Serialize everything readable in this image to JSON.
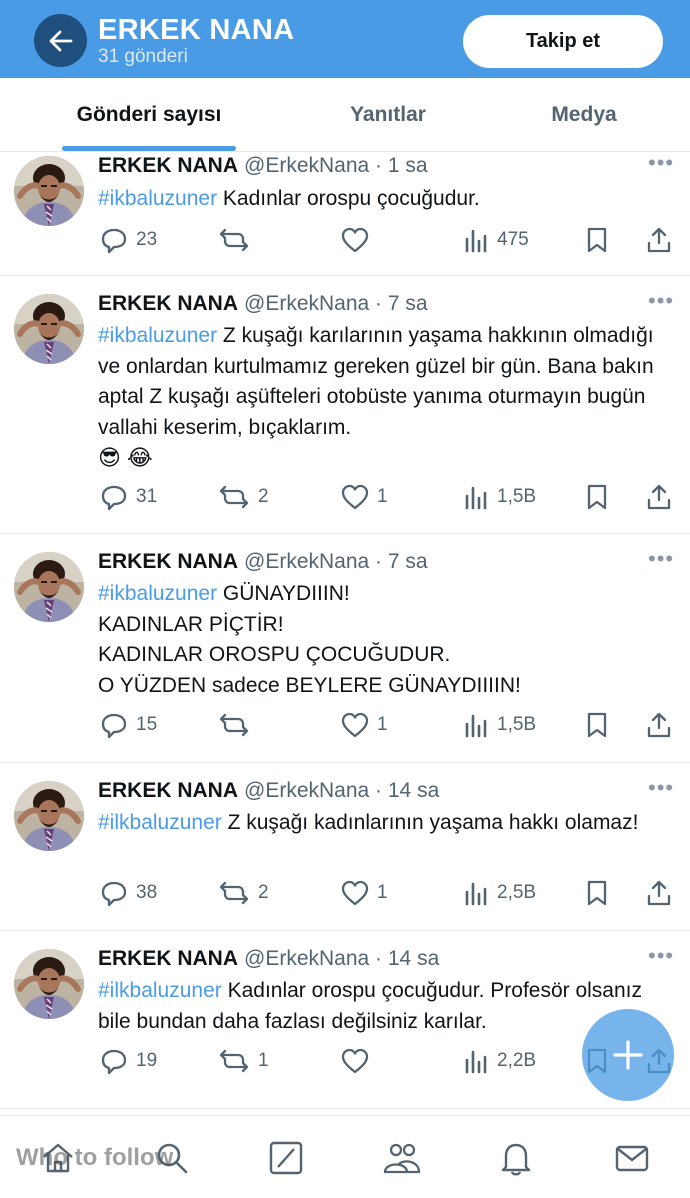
{
  "header": {
    "title": "ERKEK NANA",
    "subtitle": "31 gönderi",
    "follow_label": "Takip et"
  },
  "tabs": [
    {
      "label": "Gönderi sayısı",
      "active": true
    },
    {
      "label": "Yanıtlar",
      "active": false
    },
    {
      "label": "Medya",
      "active": false
    }
  ],
  "posts": [
    {
      "author": "ERKEK NANA",
      "meta": "@ErkekNana · 1 sa",
      "hashtag": "#ikbaluzuner",
      "text": " Kadınlar orospu çocuğudur.",
      "emoji": "",
      "replies": "23",
      "reposts": "",
      "likes": "",
      "views": "475"
    },
    {
      "author": "ERKEK NANA",
      "meta": "@ErkekNana · 7 sa",
      "hashtag": "#ikbaluzuner",
      "text": " Z kuşağı karılarının yaşama hakkının olmadığı ve onlardan kurtulmamız gereken güzel bir gün. Bana bakın aptal Z kuşağı aşüfteleri otobüste yanıma oturmayın bugün vallahi keserim, bıçaklarım.",
      "emoji": "😎 😂",
      "replies": "31",
      "reposts": "2",
      "likes": "1",
      "views": "1,5B"
    },
    {
      "author": "ERKEK NANA",
      "meta": "@ErkekNana · 7 sa",
      "hashtag": "#ikbaluzuner",
      "text": " GÜNAYDIIIN!\nKADINLAR PİÇTİR!\nKADINLAR OROSPU ÇOCUĞUDUR.\nO YÜZDEN sadece BEYLERE GÜNAYDIIIIN!",
      "emoji": "",
      "replies": "15",
      "reposts": "",
      "likes": "1",
      "views": "1,5B"
    },
    {
      "author": "ERKEK NANA",
      "meta": "@ErkekNana · 14 sa",
      "hashtag": "#ilkbaluzuner",
      "text": " Z kuşağı kadınlarının yaşama hakkı olamaz!",
      "emoji": "",
      "replies": "38",
      "reposts": "2",
      "likes": "1",
      "views": "2,5B"
    },
    {
      "author": "ERKEK NANA",
      "meta": "@ErkekNana · 14 sa",
      "hashtag": "#ilkbaluzuner",
      "text": " Kadınlar orospu çocuğudur. Profesör olsanız bile bundan daha fazlası değilsiniz karılar.",
      "emoji": "",
      "replies": "19",
      "reposts": "1",
      "likes": "",
      "views": "2,2B"
    }
  ],
  "overlay": {
    "who_to_follow": "Who to follow"
  },
  "icons": {
    "back": "arrow-left-icon",
    "more": "more-dots-icon",
    "reply": "reply-icon",
    "repost": "repost-icon",
    "like": "heart-icon",
    "views": "views-icon",
    "bookmark": "bookmark-icon",
    "share": "share-icon",
    "fab": "plus-icon",
    "nav": [
      "home-icon",
      "search-icon",
      "grok-icon",
      "communities-icon",
      "notifications-icon",
      "messages-icon"
    ]
  },
  "colors": {
    "header_bg": "#4a9be6",
    "back_button_bg": "#1f4f7c",
    "hashtag": "#4a9be6",
    "muted_text": "#536471"
  }
}
